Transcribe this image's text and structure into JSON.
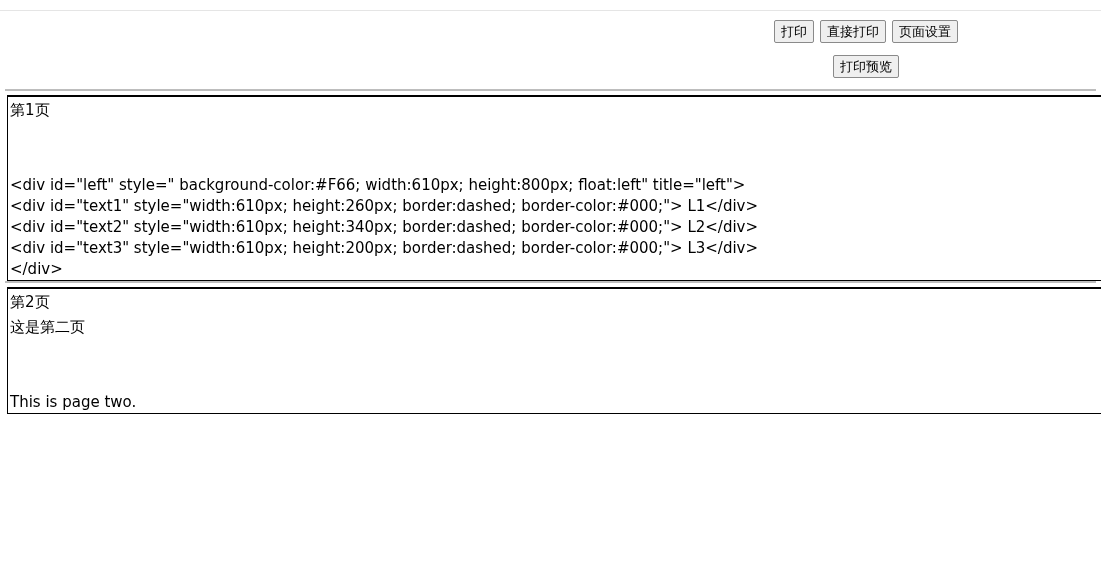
{
  "toolbar": {
    "buttons": [
      "打印",
      "直接打印",
      "页面设置"
    ],
    "preview_button": "打印预览"
  },
  "pages": [
    {
      "title": "第1页",
      "body": [
        "<div id=\"left\" style=\" background-color:#F66; width:610px; height:800px; float:left\" title=\"left\">",
        "<div id=\"text1\" style=\"width:610px; height:260px; border:dashed; border-color:#000;\"> L1</div>",
        "<div id=\"text2\" style=\"width:610px; height:340px; border:dashed; border-color:#000;\"> L2</div>",
        "<div id=\"text3\" style=\"width:610px; height:200px; border:dashed; border-color:#000;\"> L3</div>",
        "</div>"
      ]
    },
    {
      "title": "第2页",
      "intro": [
        "这是第二页"
      ],
      "body": [
        "This is page two."
      ]
    }
  ]
}
